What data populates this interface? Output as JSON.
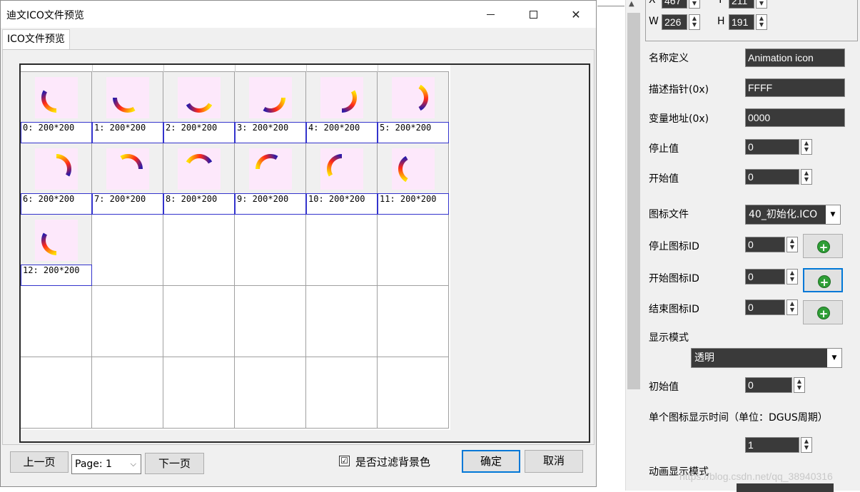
{
  "dialog": {
    "title": "迪文ICO文件预览",
    "tab": "ICO文件预览",
    "cells": [
      {
        "caption": "0:  200*200",
        "start_deg": 90
      },
      {
        "caption": "1:  200*200",
        "start_deg": 60
      },
      {
        "caption": "2:  200*200",
        "start_deg": 30
      },
      {
        "caption": "3:  200*200",
        "start_deg": 0
      },
      {
        "caption": "4:  200*200",
        "start_deg": -30
      },
      {
        "caption": "5:  200*200",
        "start_deg": -60
      },
      {
        "caption": "6:  200*200",
        "start_deg": -90
      },
      {
        "caption": "7:  200*200",
        "start_deg": -120
      },
      {
        "caption": "8:  200*200",
        "start_deg": -150
      },
      {
        "caption": "9:  200*200",
        "start_deg": 180
      },
      {
        "caption": "10:  200*200",
        "start_deg": 150
      },
      {
        "caption": "11:  200*200",
        "start_deg": 120
      },
      {
        "caption": "12:  200*200",
        "start_deg": 90
      }
    ],
    "prev_label": "上一页",
    "page_value": "Page: 1",
    "next_label": "下一页",
    "filter_label": "是否过滤背景色",
    "filter_checked": "☑",
    "ok_label": "确定",
    "cancel_label": "取消"
  },
  "props": {
    "x_label": "X",
    "x_value": "467",
    "y_label": "Y",
    "y_value": "211",
    "w_label": "W",
    "w_value": "226",
    "h_label": "H",
    "h_value": "191",
    "name_label": "名称定义",
    "name_value": "Animation icon",
    "desc_label": "描述指针(0x)",
    "desc_value": "FFFF",
    "var_label": "变量地址(0x)",
    "var_value": "0000",
    "stop_val_label": "停止值",
    "stop_val": "0",
    "start_val_label": "开始值",
    "start_val": "0",
    "icon_file_label": "图标文件",
    "icon_file_value": "40_初始化.ICO",
    "stop_icon_label": "停止图标ID",
    "stop_icon_value": "0",
    "start_icon_label": "开始图标ID",
    "start_icon_value": "0",
    "end_icon_label": "结束图标ID",
    "end_icon_value": "0",
    "display_mode_label": "显示模式",
    "display_mode_value": "透明",
    "init_label": "初始值",
    "init_value": "0",
    "single_time_label": "单个图标显示时间（单位：DGUS周期）",
    "single_time_value": "1",
    "anim_mode_label": "动画显示模式",
    "watermark": "https://blog.csdn.net/qq_38940316"
  }
}
